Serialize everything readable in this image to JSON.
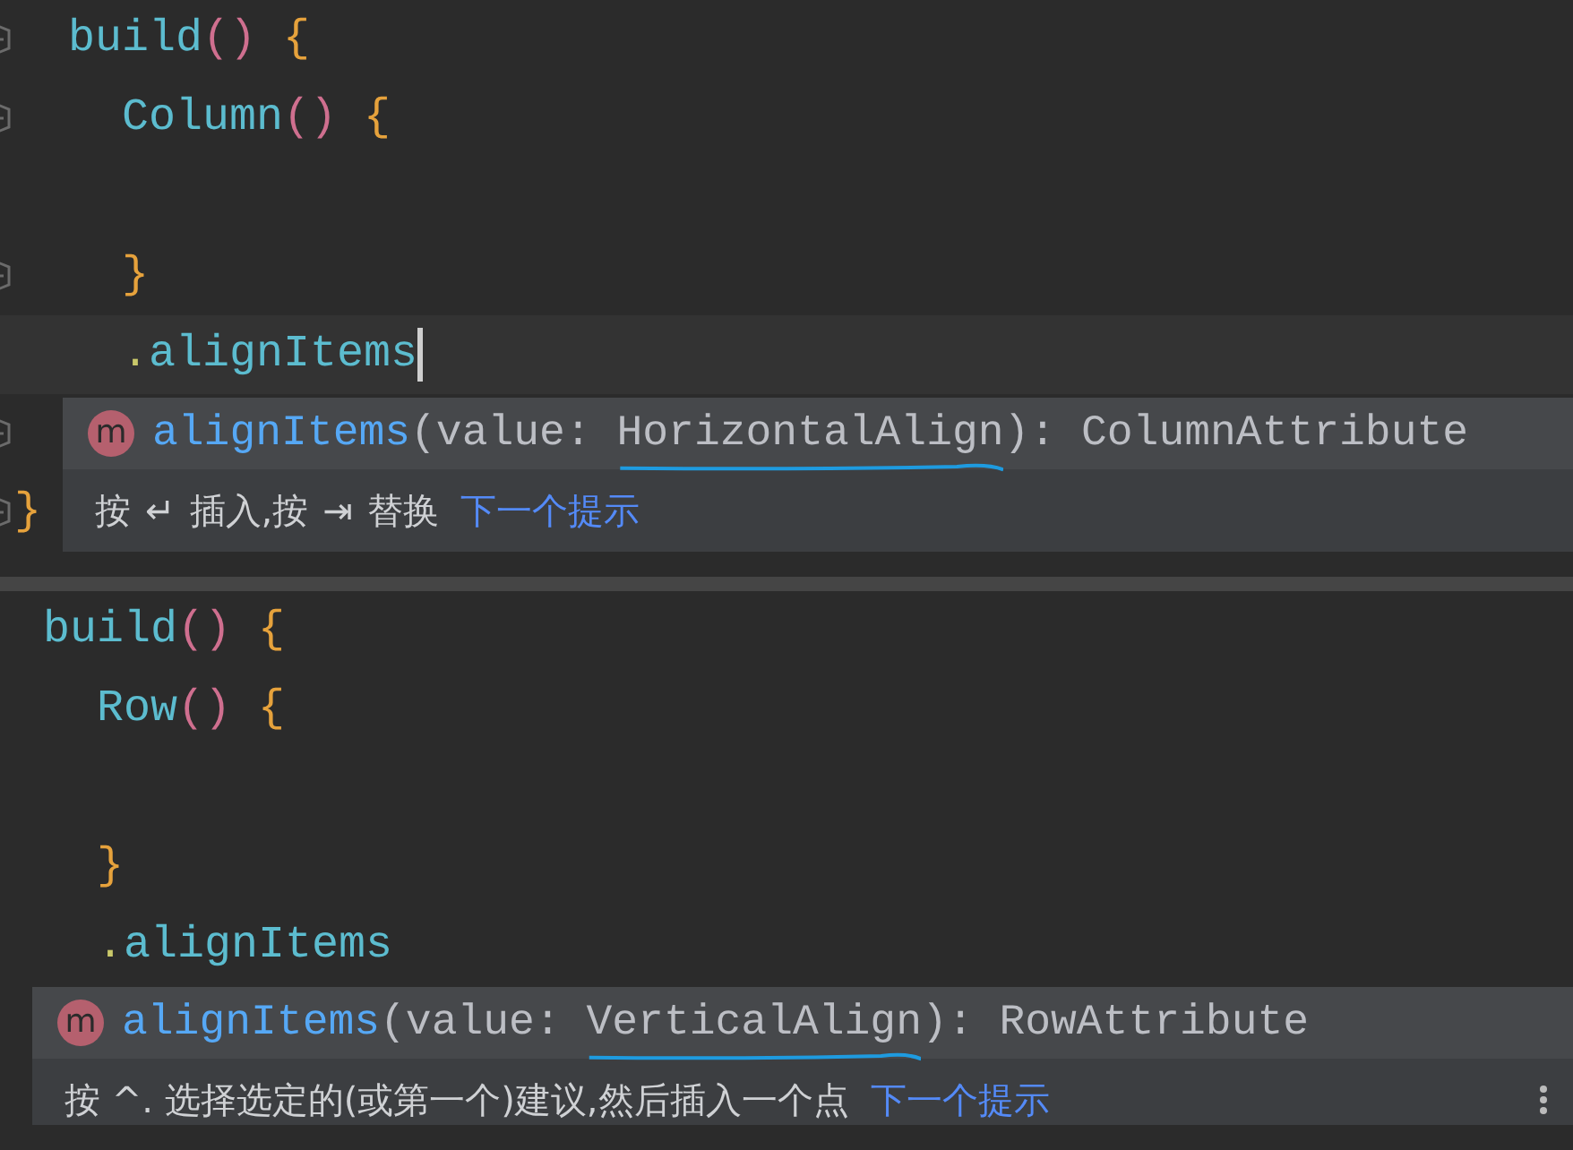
{
  "panels": [
    {
      "lines": [
        {
          "fold": true,
          "cursor": false,
          "tokens": [
            {
              "text": "  build",
              "kind": "ident"
            },
            {
              "text": "()",
              "kind": "paren"
            },
            {
              "text": " {",
              "kind": "brace"
            }
          ]
        },
        {
          "fold": true,
          "cursor": false,
          "tokens": [
            {
              "text": "    Column",
              "kind": "ident"
            },
            {
              "text": "()",
              "kind": "paren"
            },
            {
              "text": " {",
              "kind": "brace"
            }
          ]
        },
        {
          "fold": false,
          "cursor": false
        },
        {
          "fold": true,
          "cursor": false,
          "tokens": [
            {
              "text": "    }",
              "kind": "brace"
            }
          ]
        },
        {
          "fold": false,
          "cursor": true,
          "tokens": [
            {
              "text": "    .",
              "kind": "dot"
            },
            {
              "text": "alignItems",
              "kind": "ident"
            }
          ]
        },
        {
          "fold": true,
          "cursor": false
        },
        {
          "fold": true,
          "cursor": false,
          "tokens": [
            {
              "text": "}",
              "kind": "brace"
            }
          ]
        }
      ],
      "popup": {
        "icon": "m",
        "name": "alignItems",
        "before": "(value: ",
        "type": "HorizontalAlign",
        "after": "): ColumnAttribute",
        "hint": [
          {
            "text": "按",
            "kind": "text"
          },
          {
            "text": "↵",
            "kind": "key"
          },
          {
            "text": "插入,按",
            "kind": "text"
          },
          {
            "text": "⇥",
            "kind": "key"
          },
          {
            "text": "替换",
            "kind": "text"
          },
          {
            "text": "下一个提示",
            "kind": "link"
          }
        ]
      }
    },
    {
      "lines": [
        {
          "fold": false,
          "cursor": false,
          "tokens": [
            {
              "text": "build",
              "kind": "ident"
            },
            {
              "text": "()",
              "kind": "paren"
            },
            {
              "text": " {",
              "kind": "brace"
            }
          ]
        },
        {
          "fold": false,
          "cursor": false,
          "tokens": [
            {
              "text": "  Row",
              "kind": "ident"
            },
            {
              "text": "()",
              "kind": "paren"
            },
            {
              "text": " {",
              "kind": "brace"
            }
          ]
        },
        {
          "fold": false,
          "cursor": false
        },
        {
          "fold": false,
          "cursor": false,
          "tokens": [
            {
              "text": "  }",
              "kind": "brace"
            }
          ]
        },
        {
          "fold": false,
          "cursor": false,
          "tokens": [
            {
              "text": "  .",
              "kind": "dot"
            },
            {
              "text": "alignItems",
              "kind": "ident"
            }
          ]
        }
      ],
      "popup": {
        "icon": "m",
        "name": "alignItems",
        "before": "(value: ",
        "type": "VerticalAlign",
        "after": "): RowAttribute",
        "hint": [
          {
            "text": "按 ^. 选择选定的(或第一个)建议,然后插入一个点",
            "kind": "text"
          },
          {
            "text": "下一个提示",
            "kind": "link"
          }
        ]
      }
    }
  ]
}
